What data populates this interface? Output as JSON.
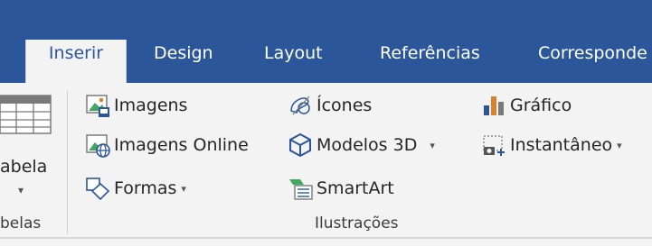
{
  "tabs": [
    {
      "label": "Inserir",
      "active": true
    },
    {
      "label": "Design",
      "active": false
    },
    {
      "label": "Layout",
      "active": false
    },
    {
      "label": "Referências",
      "active": false
    },
    {
      "label": "Corresponde",
      "active": false
    }
  ],
  "tables_group": {
    "button_label": "abela",
    "caret": "▾",
    "group_label": "belas"
  },
  "illustrations": {
    "group_label": "Ilustrações",
    "images": "Imagens",
    "online_images": "Imagens Online",
    "shapes": "Formas",
    "icons": "Ícones",
    "models3d": "Modelos 3D",
    "smartart": "SmartArt",
    "chart": "Gráfico",
    "screenshot": "Instantâneo",
    "caret": "▾"
  },
  "colors": {
    "tabbar": "#2b579a",
    "ribbon": "#f3f3f3",
    "accent_blue": "#2b579a",
    "chart_orange": "#d9822b"
  },
  "icons": [
    "table-icon",
    "image-icon",
    "online-image-icon",
    "shapes-icon",
    "icons-icon",
    "3d-models-icon",
    "smartart-icon",
    "chart-icon",
    "screenshot-icon"
  ]
}
